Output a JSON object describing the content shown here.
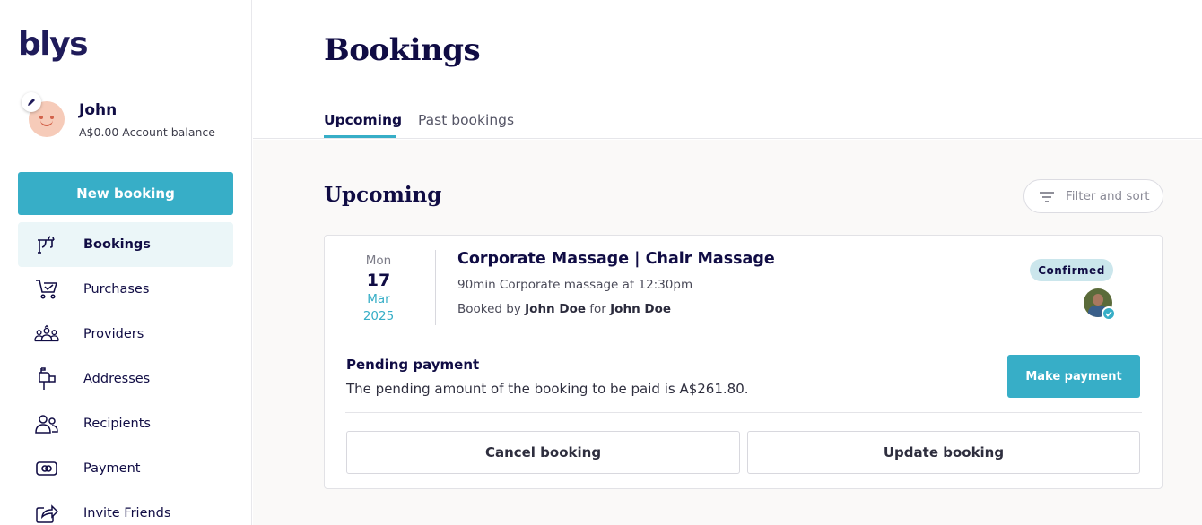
{
  "brand": {
    "logo": "blys",
    "accent": "#37aec7",
    "navy": "#100c44"
  },
  "profile": {
    "name": "John",
    "balance": "A$0.00 Account balance"
  },
  "sidebar": {
    "new_booking_label": "New booking",
    "items": [
      {
        "label": "Bookings",
        "icon": "bookings-icon",
        "active": true
      },
      {
        "label": "Purchases",
        "icon": "cart-icon"
      },
      {
        "label": "Providers",
        "icon": "providers-icon"
      },
      {
        "label": "Addresses",
        "icon": "mailbox-icon"
      },
      {
        "label": "Recipients",
        "icon": "recipients-icon"
      },
      {
        "label": "Payment",
        "icon": "payment-card-icon"
      },
      {
        "label": "Invite Friends",
        "icon": "share-icon"
      }
    ]
  },
  "page": {
    "title": "Bookings",
    "tabs": [
      {
        "label": "Upcoming",
        "active": true
      },
      {
        "label": "Past bookings"
      }
    ]
  },
  "section": {
    "title": "Upcoming",
    "filter_label": "Filter and sort"
  },
  "booking": {
    "date": {
      "dow": "Mon",
      "day": "17",
      "month": "Mar",
      "year": "2025"
    },
    "title": "Corporate Massage | Chair Massage",
    "description": "90min Corporate massage at 12:30pm",
    "booked_by_prefix": "Booked by ",
    "booked_by": "John Doe",
    "for_prefix": " for ",
    "booked_for": "John Doe",
    "status": "Confirmed",
    "pending_title": "Pending payment",
    "pending_text": "The pending amount of the booking to be paid is A$261.80.",
    "make_payment_label": "Make payment",
    "cancel_label": "Cancel booking",
    "update_label": "Update booking"
  }
}
